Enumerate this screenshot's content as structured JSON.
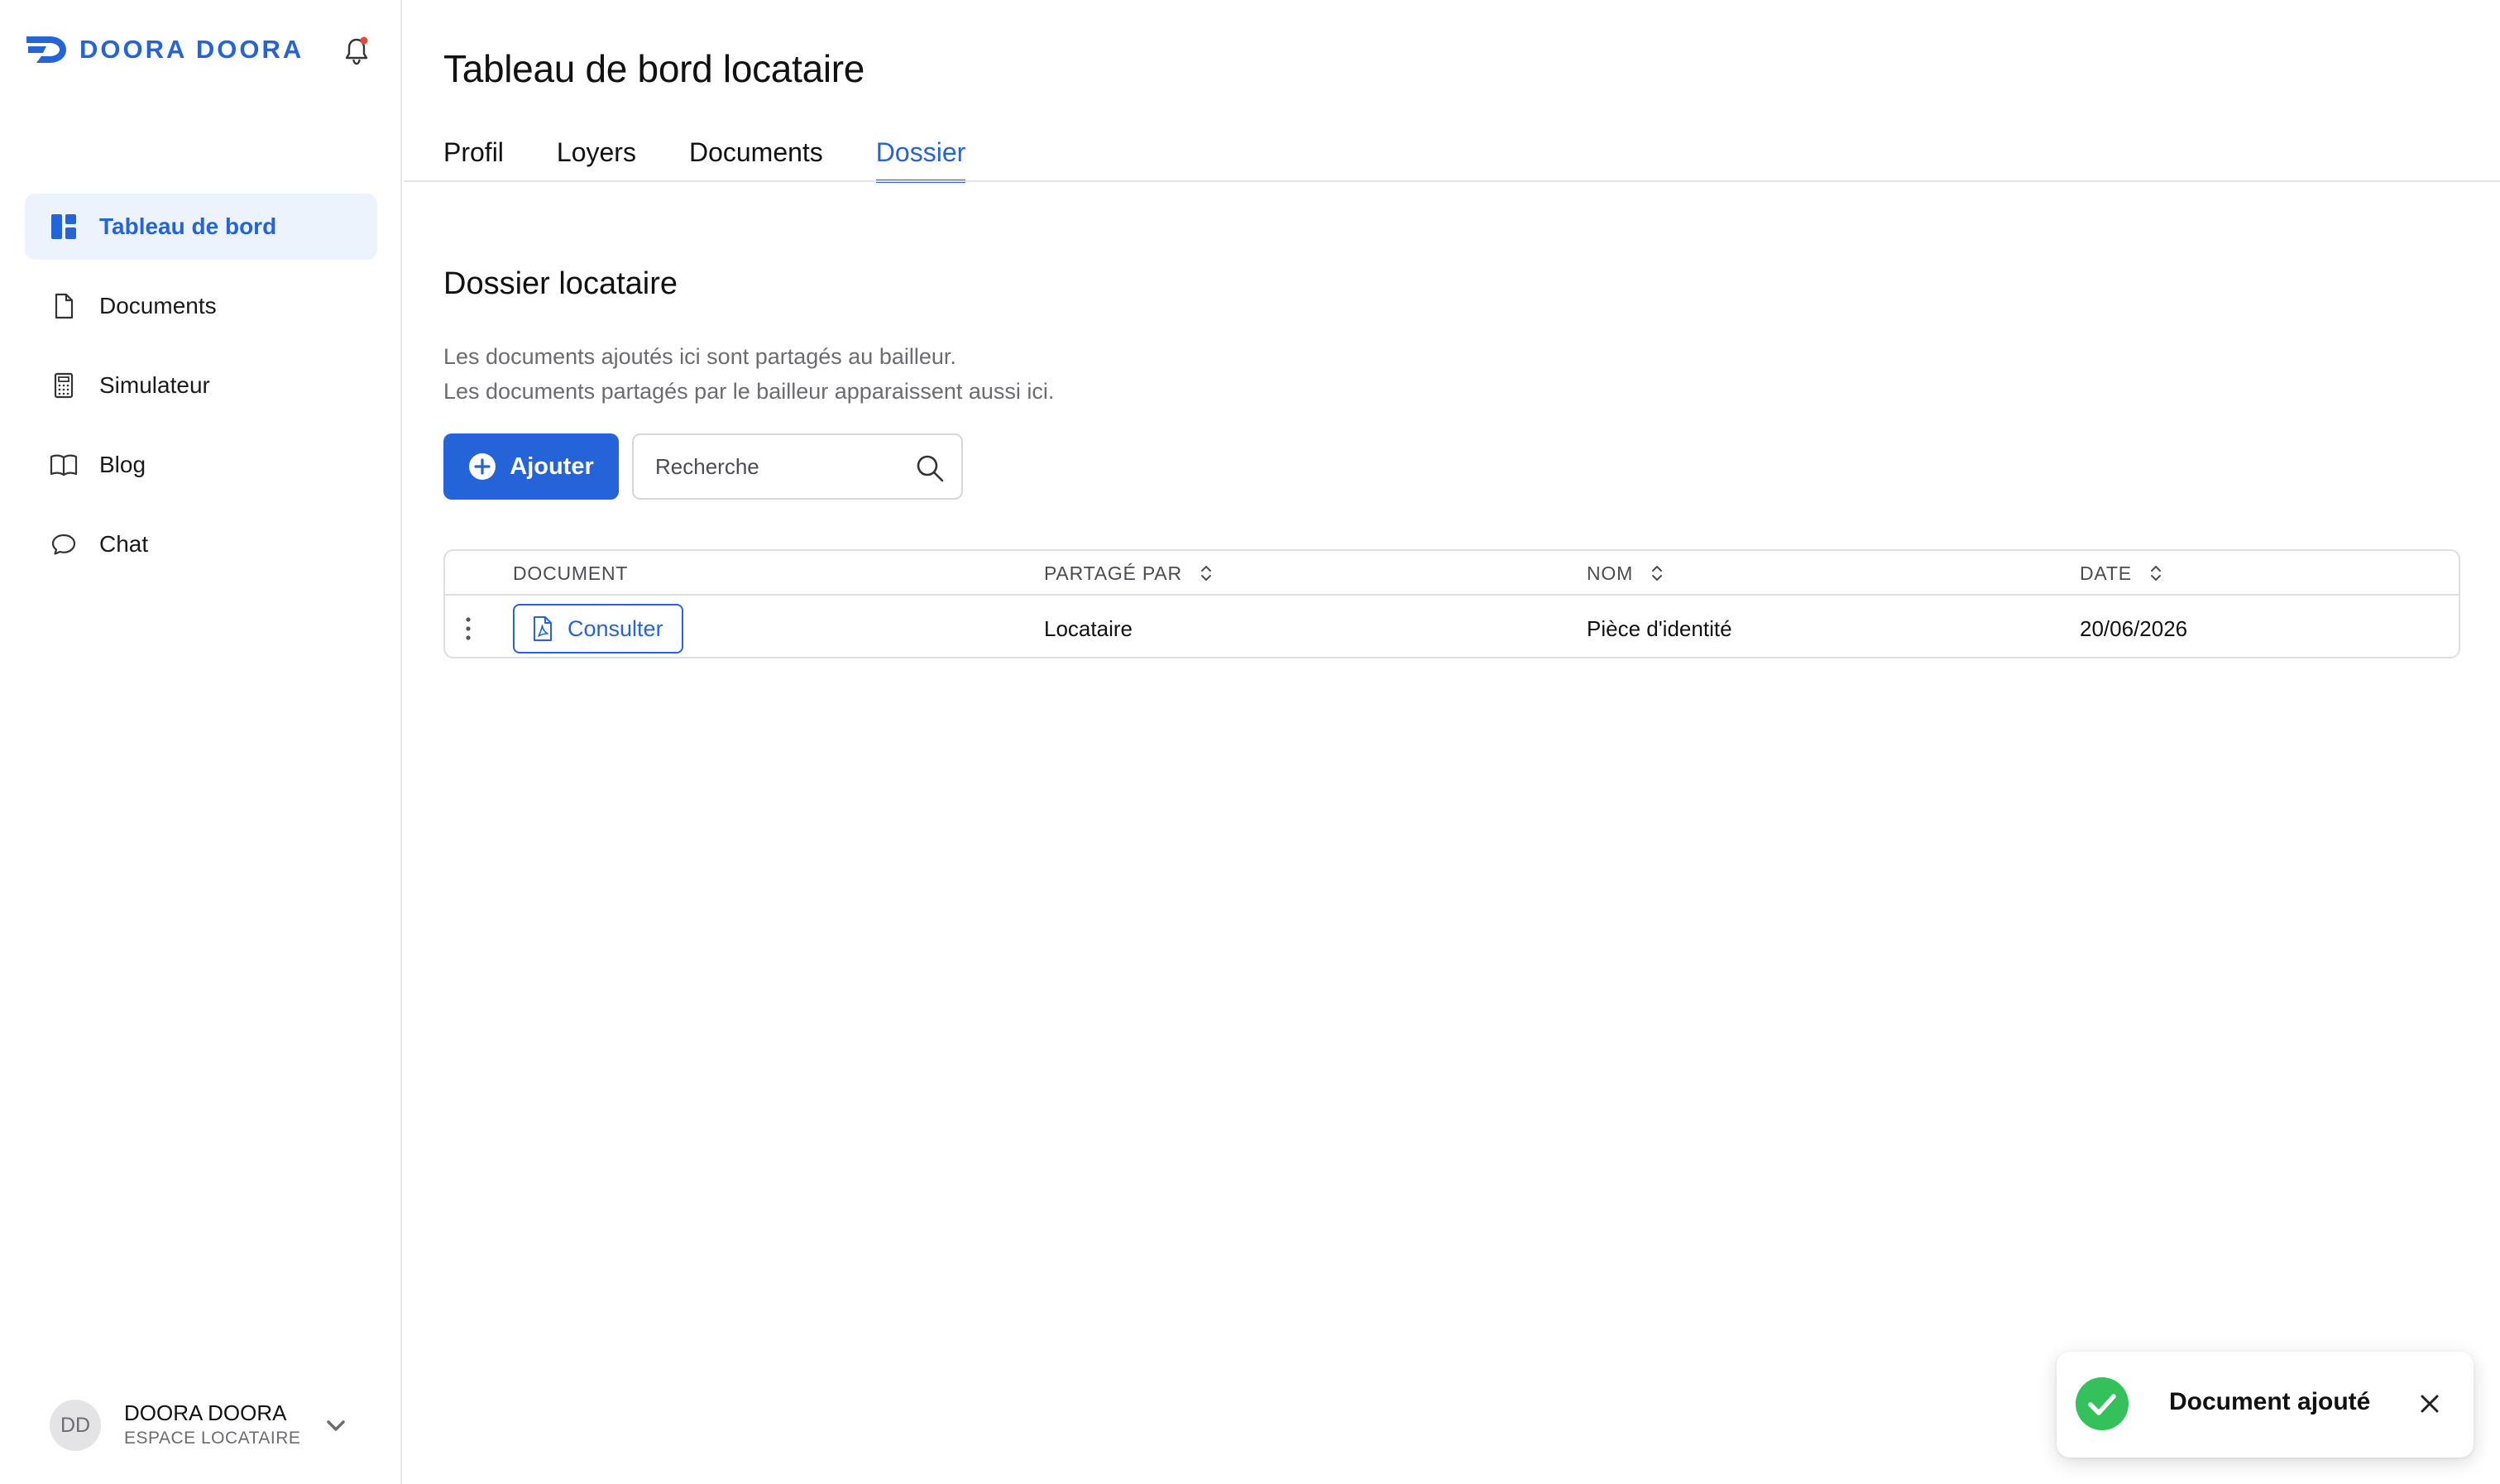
{
  "sidebar": {
    "brand": "DOORA DOORA",
    "items": [
      {
        "label": "Tableau de bord",
        "icon": "dashboard-icon",
        "active": true
      },
      {
        "label": "Documents",
        "icon": "document-icon"
      },
      {
        "label": "Simulateur",
        "icon": "calculator-icon"
      },
      {
        "label": "Blog",
        "icon": "book-icon"
      },
      {
        "label": "Chat",
        "icon": "chat-bubble-icon"
      }
    ],
    "user": {
      "initials": "DD",
      "name": "DOORA DOORA",
      "role": "ESPACE LOCATAIRE"
    }
  },
  "header": {
    "title": "Tableau de bord locataire",
    "tabs": [
      {
        "label": "Profil"
      },
      {
        "label": "Loyers"
      },
      {
        "label": "Documents"
      },
      {
        "label": "Dossier",
        "active": true
      }
    ]
  },
  "dossier": {
    "title": "Dossier locataire",
    "description": [
      "Les documents ajoutés ici sont partagés au bailleur.",
      "Les documents partagés par le bailleur apparaissent aussi ici."
    ],
    "add_label": "Ajouter",
    "search_placeholder": "Recherche"
  },
  "table": {
    "columns": [
      "DOCUMENT",
      "PARTAGÉ PAR",
      "NOM",
      "DATE"
    ],
    "rows": [
      {
        "action_label": "Consulter",
        "shared_by": "Locataire",
        "name": "Pièce d'identité",
        "date": "20/06/2026"
      }
    ]
  },
  "toast": {
    "message": "Document ajouté",
    "status": "success"
  },
  "colors": {
    "accent": "#2563d9",
    "active_bg": "#edf3fd",
    "success": "#34c05a",
    "muted_text": "#6b6b72",
    "border": "#dcdfe4"
  }
}
